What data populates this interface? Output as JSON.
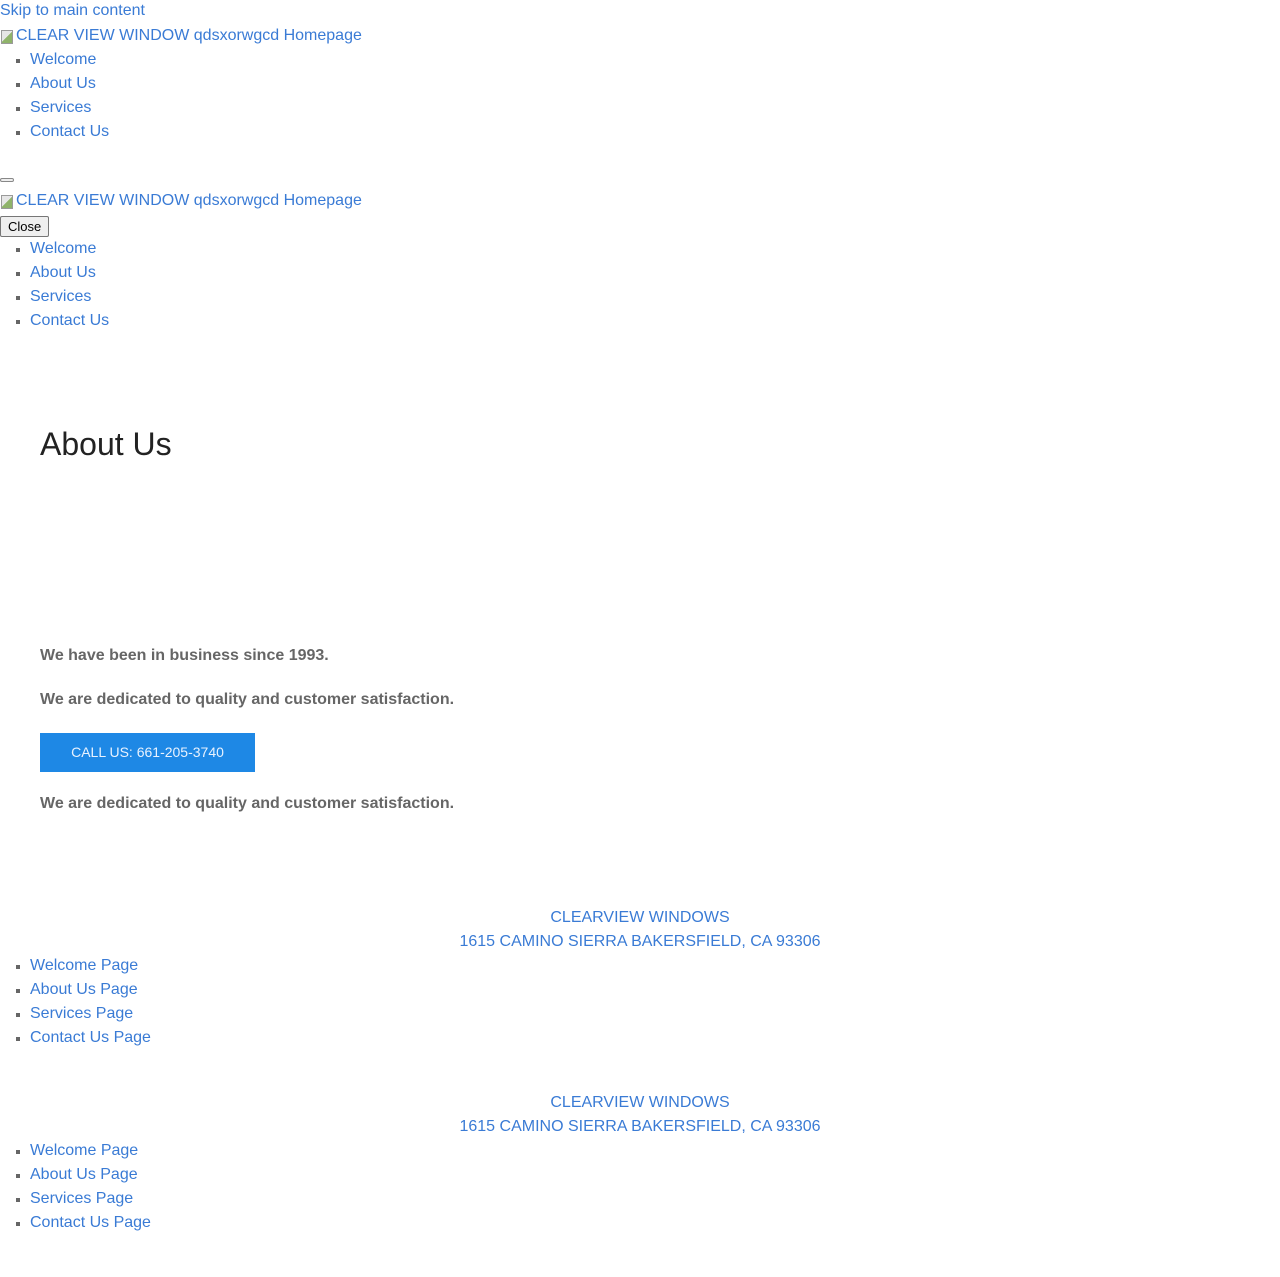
{
  "skip_link": "Skip to main content",
  "logo_alt": "CLEAR VIEW WINDOW qdsxorwgcd Homepage",
  "header_nav": [
    "Welcome",
    "About Us",
    "Services",
    "Contact Us"
  ],
  "mobile_menu": {
    "logo_alt": "CLEAR VIEW WINDOW qdsxorwgcd Homepage",
    "close_label": "Close",
    "nav": [
      "Welcome",
      "About Us",
      "Services",
      "Contact Us"
    ]
  },
  "main": {
    "title": "About Us",
    "paragraph_1": "We have been in business since 1993.",
    "paragraph_2": "We are dedicated to quality and customer satisfaction.",
    "call_button": "CALL US: 661-205-3740",
    "paragraph_3": "We are dedicated to quality and customer satisfaction."
  },
  "footers": [
    {
      "company": "CLEARVIEW WINDOWS",
      "address": "1615 CAMINO SIERRA BAKERSFIELD, CA 93306",
      "links": [
        "Welcome Page",
        "About Us Page",
        "Services Page",
        "Contact Us Page"
      ]
    },
    {
      "company": "CLEARVIEW WINDOWS",
      "address": "1615 CAMINO SIERRA BAKERSFIELD, CA 93306",
      "links": [
        "Welcome Page",
        "About Us Page",
        "Services Page",
        "Contact Us Page"
      ]
    }
  ],
  "colors": {
    "link": "#3a7bd5",
    "button_bg": "#1e88e5",
    "body_text": "#666666",
    "heading": "#222222"
  }
}
